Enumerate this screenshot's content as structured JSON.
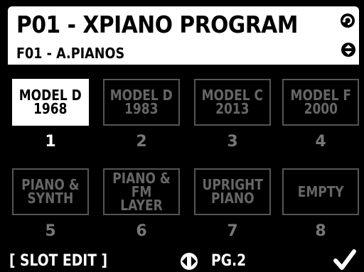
{
  "header": {
    "title": "P01 - XPIANO PROGRAM",
    "subtitle": "F01 - A.PIANOS",
    "icons": [
      "refresh-icon",
      "up-down-icon"
    ]
  },
  "slots": [
    {
      "label": "MODEL D\n1968",
      "number": "1",
      "selected": true
    },
    {
      "label": "MODEL D\n1983",
      "number": "2",
      "selected": false
    },
    {
      "label": "MODEL C\n2013",
      "number": "3",
      "selected": false
    },
    {
      "label": "MODEL F\n2000",
      "number": "4",
      "selected": false
    },
    {
      "label": "PIANO &\nSYNTH",
      "number": "5",
      "selected": false
    },
    {
      "label": "PIANO &\nFM LAYER",
      "number": "6",
      "selected": false
    },
    {
      "label": "UPRIGHT\nPIANO",
      "number": "7",
      "selected": false
    },
    {
      "label": "EMPTY",
      "number": "8",
      "selected": false
    }
  ],
  "footer": {
    "slot_edit": "[ SLOT EDIT ]",
    "page": "PG.2",
    "icons": [
      "left-right-arrow-icon",
      "checkmark-icon"
    ]
  },
  "colors": {
    "background": "#000000",
    "header_bg": "#ffffff",
    "inactive": "#666666",
    "active": "#ffffff"
  }
}
